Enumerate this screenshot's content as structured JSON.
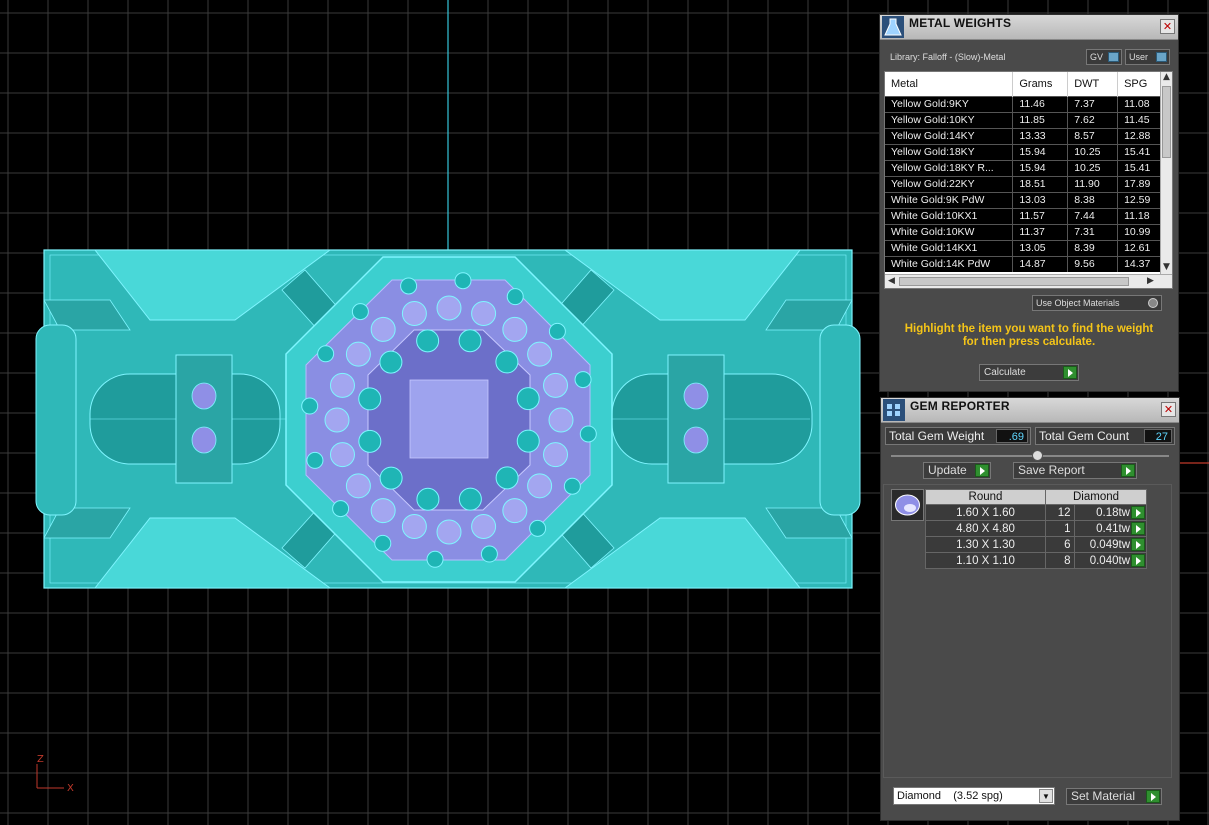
{
  "metal_weights": {
    "title": "METAL WEIGHTS",
    "library": "Library: Falloff - (Slow)-Metal",
    "gv_label": "GV",
    "user_label": "User",
    "columns": [
      "Metal",
      "Grams",
      "DWT",
      "SPG"
    ],
    "rows": [
      [
        "Yellow Gold:9KY",
        "11.46",
        "7.37",
        "11.08"
      ],
      [
        "Yellow Gold:10KY",
        "11.85",
        "7.62",
        "11.45"
      ],
      [
        "Yellow Gold:14KY",
        "13.33",
        "8.57",
        "12.88"
      ],
      [
        "Yellow Gold:18KY",
        "15.94",
        "10.25",
        "15.41"
      ],
      [
        "Yellow Gold:18KY R...",
        "15.94",
        "10.25",
        "15.41"
      ],
      [
        "Yellow Gold:22KY",
        "18.51",
        "11.90",
        "17.89"
      ],
      [
        "White Gold:9K PdW",
        "13.03",
        "8.38",
        "12.59"
      ],
      [
        "White Gold:10KX1",
        "11.57",
        "7.44",
        "11.18"
      ],
      [
        "White Gold:10KW",
        "11.37",
        "7.31",
        "10.99"
      ],
      [
        "White Gold:14KX1",
        "13.05",
        "8.39",
        "12.61"
      ],
      [
        "White Gold:14K PdW",
        "14.87",
        "9.56",
        "14.37"
      ]
    ],
    "use_object_materials": "Use Object Materials",
    "hint": "Highlight the item you want to find the weight for then press calculate.",
    "calculate_label": "Calculate"
  },
  "gem_reporter": {
    "title": "GEM REPORTER",
    "total_weight_label": "Total Gem Weight",
    "total_weight_value": ".69",
    "total_count_label": "Total Gem Count",
    "total_count_value": "27",
    "update_label": "Update",
    "save_report_label": "Save Report",
    "shape_header": "Round",
    "type_header": "Diamond",
    "gems": [
      {
        "size": "1.60 X 1.60",
        "count": "12",
        "weight": "0.18tw"
      },
      {
        "size": "4.80 X 4.80",
        "count": "1",
        "weight": "0.41tw"
      },
      {
        "size": "1.30 X 1.30",
        "count": "6",
        "weight": "0.049tw"
      },
      {
        "size": "1.10 X 1.10",
        "count": "8",
        "weight": "0.040tw"
      }
    ],
    "material_select": "Diamond    (3.52 spg)",
    "set_material_label": "Set Material"
  },
  "viewport": {
    "axis_z": "Z",
    "axis_x": "X",
    "colors": {
      "grid": "#3a3a3a",
      "model": "#38d6d6",
      "wire": "#7ff5ff",
      "gem": "#8f8fe6",
      "axis_red": "#c0392b"
    }
  }
}
